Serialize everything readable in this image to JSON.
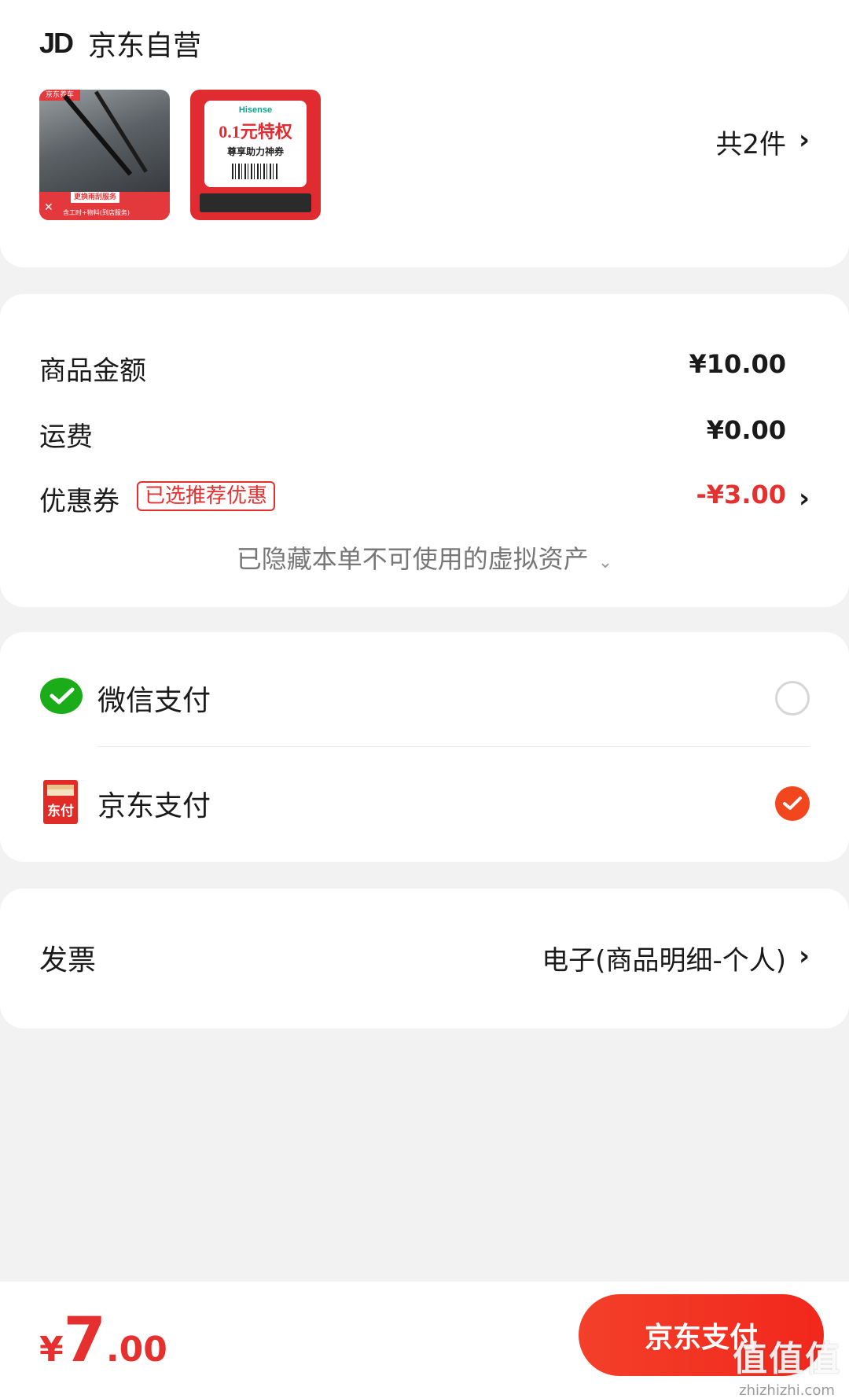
{
  "store": {
    "logo_text": "JD",
    "name": "京东自营",
    "item_count": "共2件",
    "chevron": "›"
  },
  "products": [
    {
      "tag": "京东养车",
      "banner": "更换雨刮服务",
      "sub": "含工时+物料(到店服务)",
      "icon": "wrench-icon"
    },
    {
      "brand": "Hisense",
      "price_text": "0.1元特权",
      "sub": "尊享助力神券"
    }
  ],
  "price_summary": {
    "goods_label": "商品金额",
    "goods_value": "¥10.00",
    "shipping_label": "运费",
    "shipping_value": "¥0.00",
    "coupon_label": "优惠券",
    "coupon_badge": "已选推荐优惠",
    "coupon_value": "-¥3.00",
    "hidden_note": "已隐藏本单不可使用的虚拟资产",
    "hidden_caret": "⌄"
  },
  "payment": {
    "options": [
      {
        "label": "微信支付",
        "icon": "wechat-pay-icon",
        "selected": false
      },
      {
        "label": "京东支付",
        "icon": "jd-pay-icon",
        "icon_text": "东付",
        "selected": true
      }
    ]
  },
  "invoice": {
    "label": "发票",
    "value": "电子(商品明细-个人)"
  },
  "footer": {
    "currency": "¥",
    "total_integer": "7",
    "total_decimal": ".00",
    "pay_button": "京东支付",
    "watermark_main": "值值值",
    "watermark_sub": "zhizhizhi.com"
  },
  "colors": {
    "accent_red": "#e5302f",
    "button_red": "#f2271c",
    "wechat_green": "#1aad19",
    "background": "#f2f2f2"
  }
}
